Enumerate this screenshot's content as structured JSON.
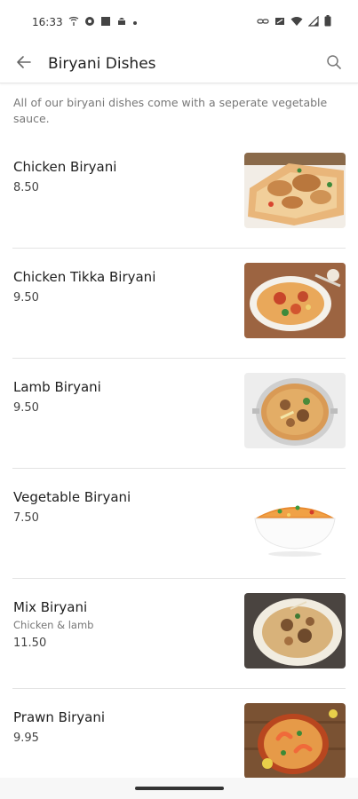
{
  "status": {
    "time": "16:33",
    "left_icons": [
      "wireless-call-icon",
      "settings-badge-icon",
      "square-app-icon",
      "android-icon",
      "dot"
    ],
    "right_icons": [
      "link-icon",
      "battery-saver-icon",
      "wifi-icon",
      "signal-icon",
      "battery-icon"
    ]
  },
  "header": {
    "title": "Biryani Dishes"
  },
  "description": "All of our biryani dishes come with a seperate vegetable sauce.",
  "items": [
    {
      "name": "Chicken Biryani",
      "subtitle": "",
      "price": "8.50"
    },
    {
      "name": "Chicken Tikka Biryani",
      "subtitle": "",
      "price": "9.50"
    },
    {
      "name": "Lamb Biryani",
      "subtitle": "",
      "price": "9.50"
    },
    {
      "name": "Vegetable Biryani",
      "subtitle": "",
      "price": "7.50"
    },
    {
      "name": "Mix Biryani",
      "subtitle": "Chicken & lamb",
      "price": "11.50"
    },
    {
      "name": "Prawn Biryani",
      "subtitle": "",
      "price": "9.95"
    }
  ],
  "colors": {
    "background": "#ffffff",
    "divider": "#e3e3e3",
    "text_primary": "#1f1f1f",
    "text_secondary": "#777777"
  }
}
